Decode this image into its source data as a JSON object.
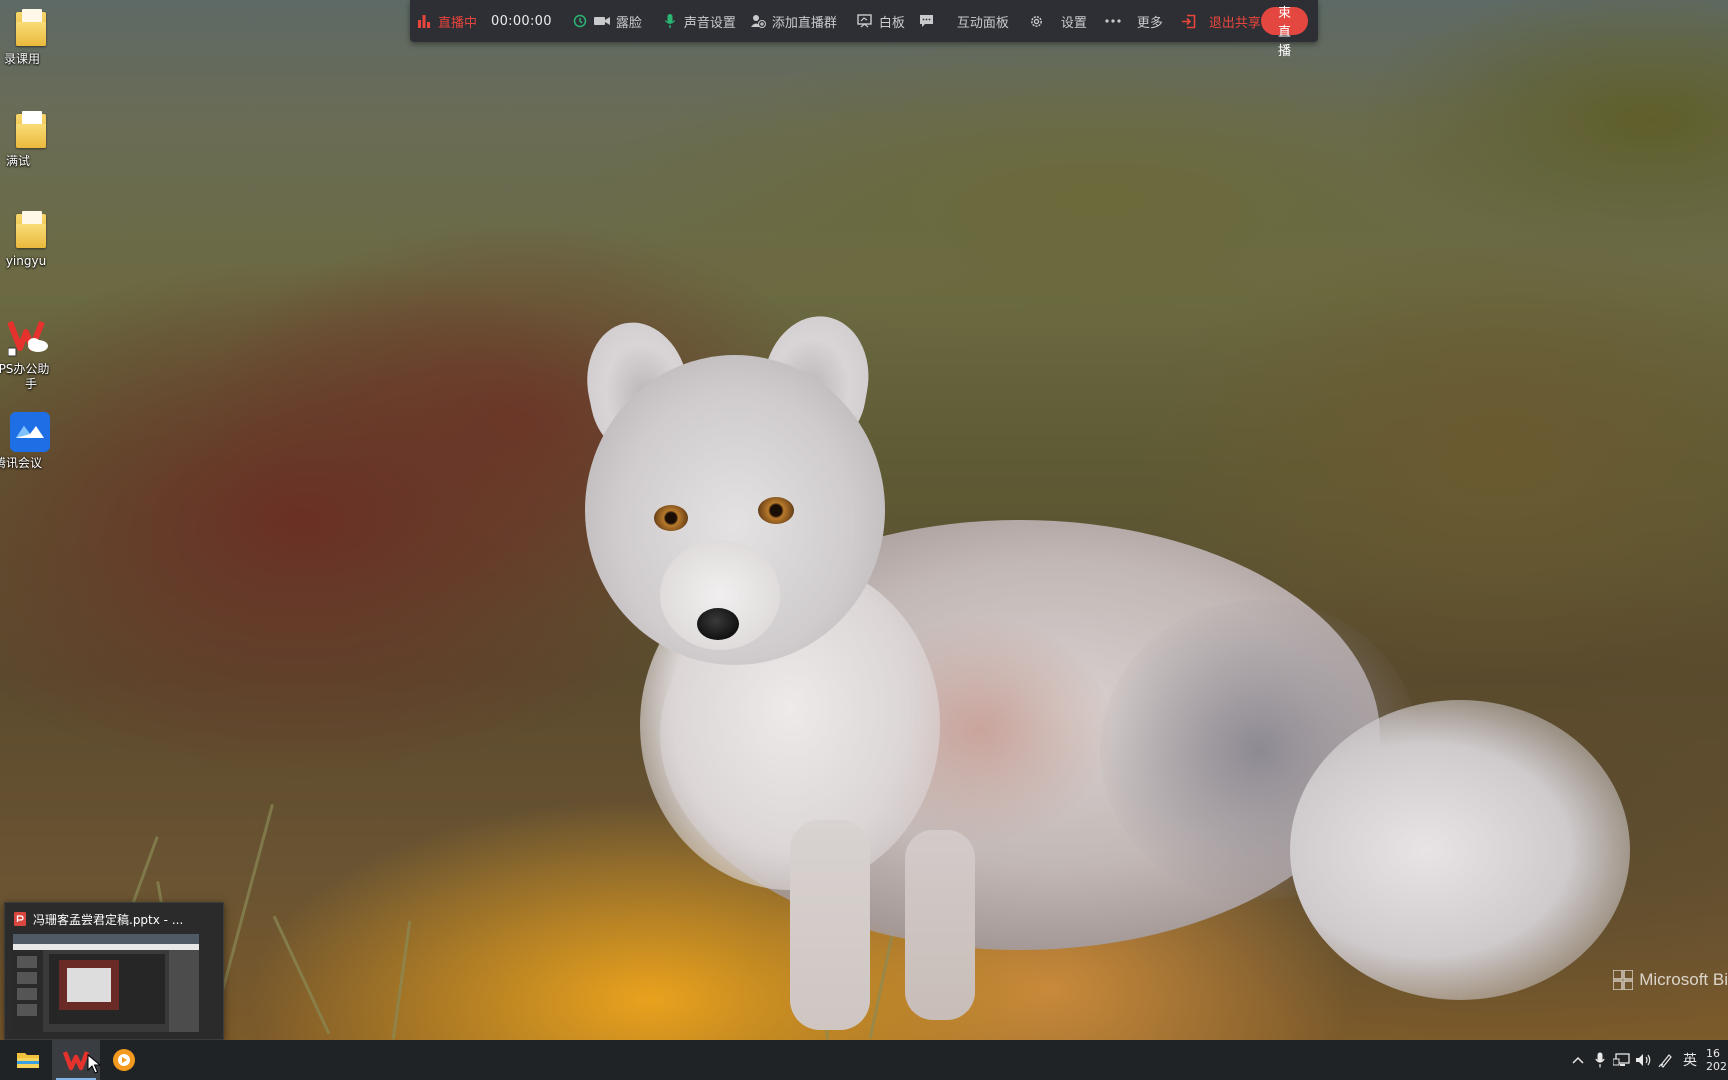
{
  "toolbar": {
    "live_status": "直播中",
    "timer": "00:00:00",
    "camera_label": "露脸",
    "audio_label": "声音设置",
    "add_group_label": "添加直播群",
    "whiteboard_label": "白板",
    "interaction_label": "互动面板",
    "settings_label": "设置",
    "more_label": "更多",
    "exit_share_label": "退出共享",
    "end_live_label": "结束直播",
    "colors": {
      "background": "#2d2f34",
      "accent_red": "#e34740",
      "active_green": "#2bb673"
    }
  },
  "desktop": {
    "icons": [
      {
        "label": "录课用",
        "icon": "folder-icon"
      },
      {
        "label": "满试",
        "icon": "folder-icon"
      },
      {
        "label": "yingyu",
        "icon": "folder-icon"
      },
      {
        "label_line1": "PS办公助",
        "label_line2": "手",
        "icon": "wps-assistant-icon"
      },
      {
        "label": "腾讯会议",
        "icon": "tencent-meeting-icon"
      }
    ]
  },
  "preview": {
    "title": "冯珊客孟尝君定稿.pptx - ..."
  },
  "watermark": {
    "text": "Microsoft Bi"
  },
  "taskbar": {
    "apps": [
      {
        "name": "file-explorer-icon"
      },
      {
        "name": "wps-icon",
        "active": true
      },
      {
        "name": "live-app-icon"
      }
    ],
    "tray": {
      "ime": "英",
      "clock_line1": "16",
      "clock_line2": "202"
    }
  }
}
